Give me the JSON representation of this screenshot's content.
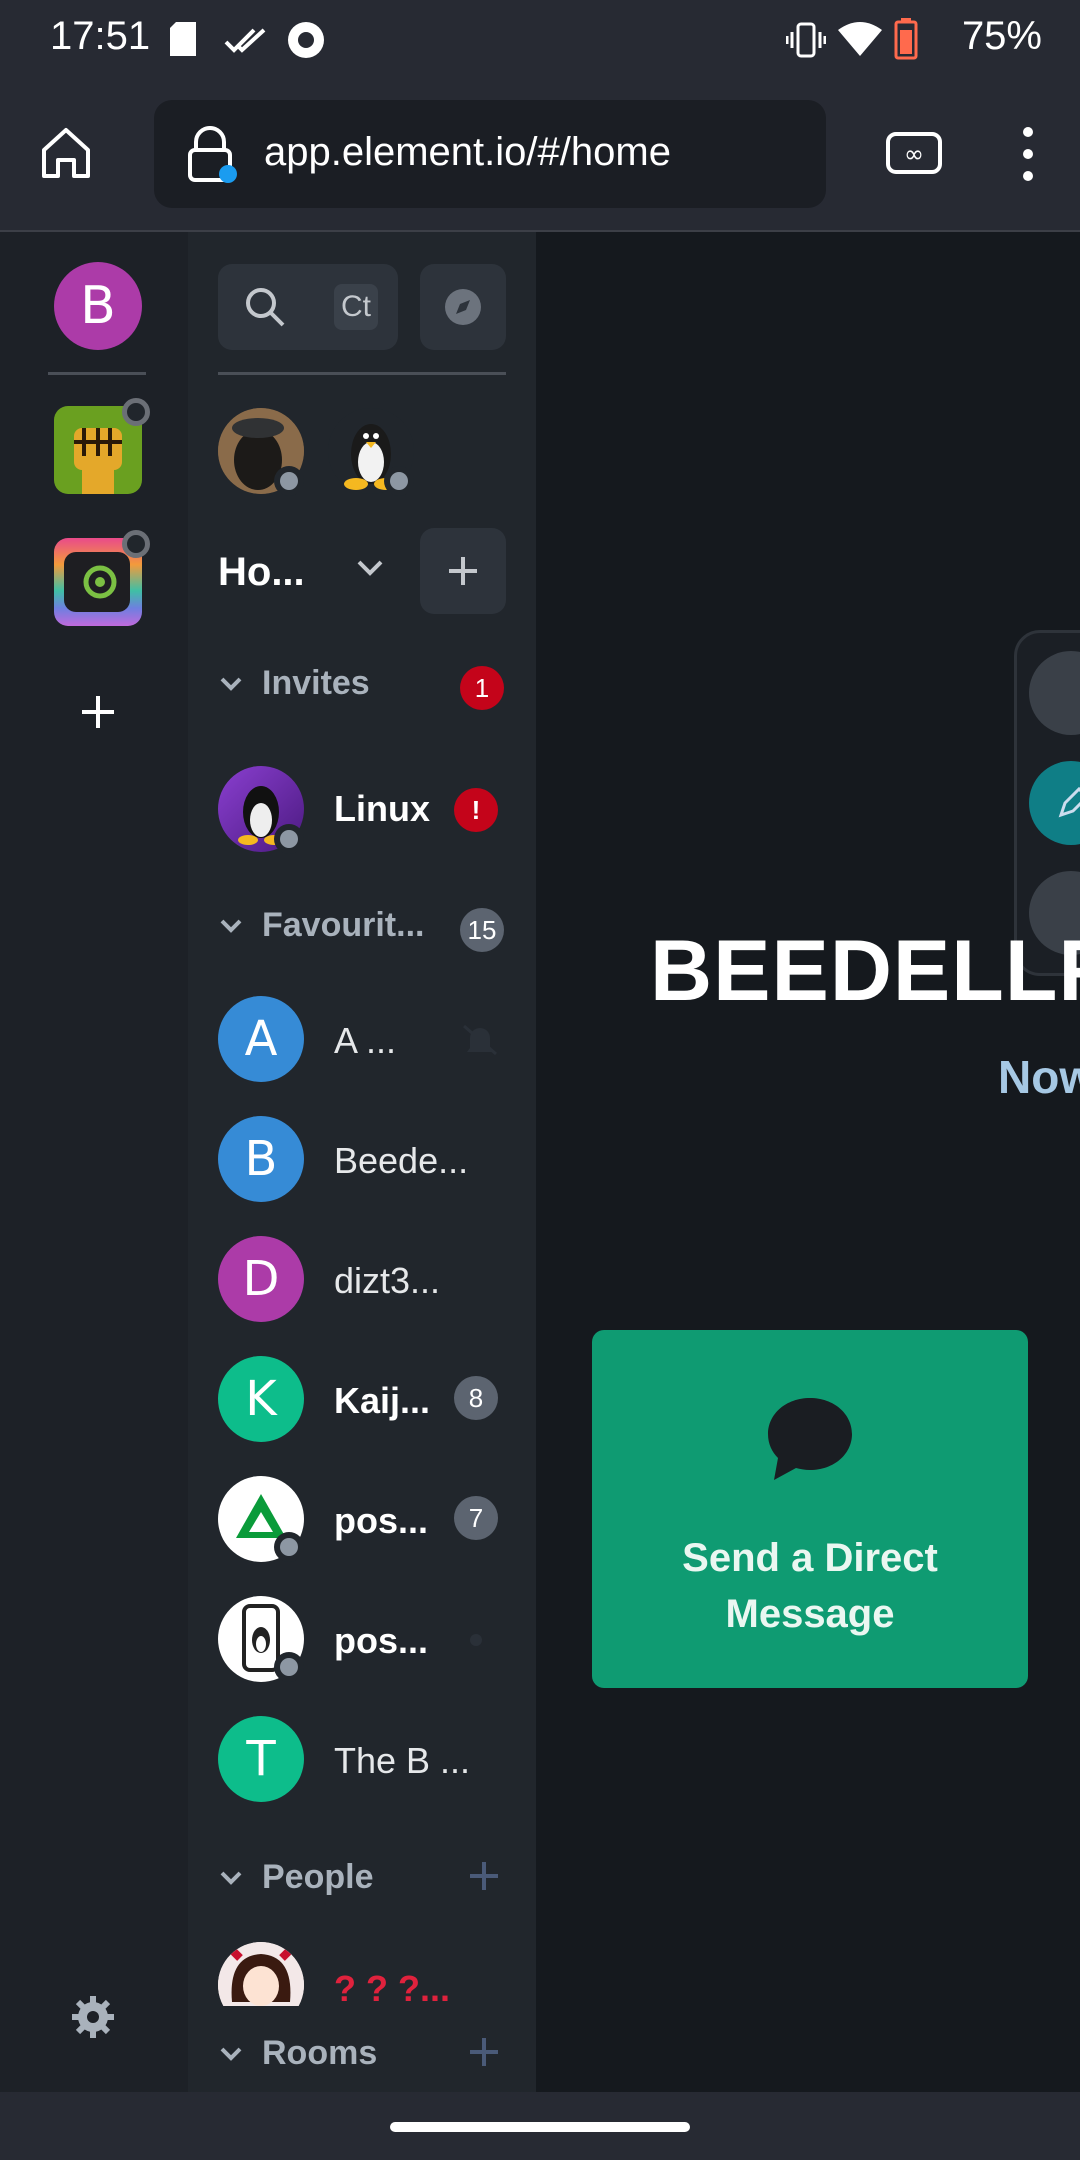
{
  "status": {
    "time": "17:51",
    "battery": "75%"
  },
  "browser": {
    "url": "app.element.io/#/home"
  },
  "spaces": {
    "user_initial": "B"
  },
  "roomlist": {
    "search_shortcut": "Ct",
    "home_label": "Ho...",
    "invites": {
      "title": "Invites",
      "count": "1",
      "items": [
        {
          "name": "Linux",
          "badge": "!"
        }
      ]
    },
    "favourites": {
      "title": "Favourit...",
      "count": "15",
      "items": [
        {
          "initial": "A",
          "name": "A ...",
          "badge": ""
        },
        {
          "initial": "B",
          "name": "Beede...",
          "badge": ""
        },
        {
          "initial": "D",
          "name": "dizt3...",
          "badge": ""
        },
        {
          "initial": "K",
          "name": "Kaij...",
          "badge": "8"
        },
        {
          "initial": "",
          "name": "pos...",
          "badge": "7"
        },
        {
          "initial": "",
          "name": "pos...",
          "badge": ""
        },
        {
          "initial": "T",
          "name": "The B ...",
          "badge": ""
        }
      ]
    },
    "people": {
      "title": "People",
      "items": [
        {
          "name": "? ? ?..."
        }
      ]
    },
    "rooms": {
      "title": "Rooms"
    }
  },
  "main": {
    "heading": "BEEDELLR",
    "subheading": "Now",
    "dm_card_label": "Send a Direct Message"
  },
  "colors": {
    "accent": "#0dbd8b",
    "card": "#0f9b72",
    "badge_red": "#c4041a",
    "badge_gray": "#5c6470"
  }
}
